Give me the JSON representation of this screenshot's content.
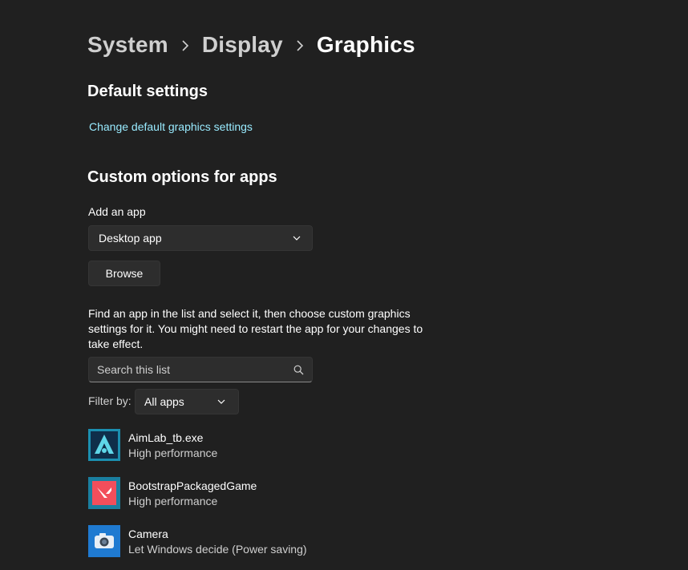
{
  "breadcrumb": {
    "items": [
      "System",
      "Display",
      "Graphics"
    ]
  },
  "default_settings": {
    "title": "Default settings",
    "link": "Change default graphics settings"
  },
  "custom_options": {
    "title": "Custom options for apps",
    "add_app_label": "Add an app",
    "app_type_selected": "Desktop app",
    "browse_label": "Browse",
    "description": "Find an app in the list and select it, then choose custom graphics settings for it. You might need to restart the app for your changes to take effect.",
    "search_placeholder": "Search this list",
    "filter_label": "Filter by:",
    "filter_selected": "All apps"
  },
  "apps": [
    {
      "name": "AimLab_tb.exe",
      "status": "High performance",
      "icon": "aimlab-icon"
    },
    {
      "name": "BootstrapPackagedGame",
      "status": "High performance",
      "icon": "valorant-icon"
    },
    {
      "name": "Camera",
      "status": "Let Windows decide (Power saving)",
      "icon": "camera-icon"
    }
  ],
  "colors": {
    "background": "#202020",
    "link": "#99ebff",
    "control": "#2d2d2d"
  }
}
